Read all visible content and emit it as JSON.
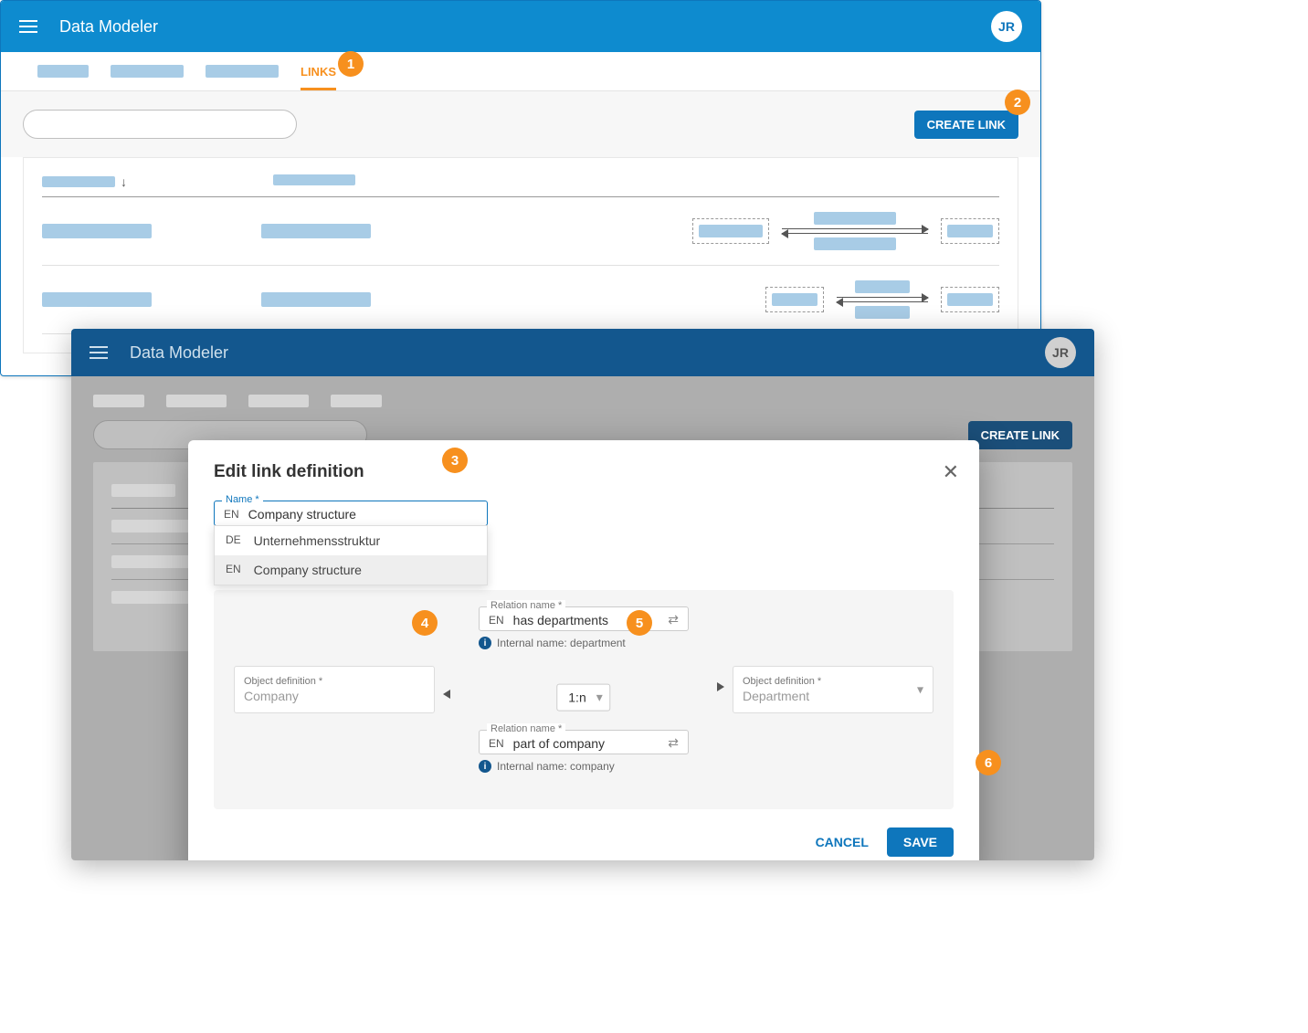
{
  "header": {
    "app_title": "Data Modeler",
    "avatar": "JR"
  },
  "tabs": {
    "active_label": "LINKS"
  },
  "toolbar": {
    "create_link": "CREATE LINK"
  },
  "modal": {
    "title": "Edit link definition",
    "name_label": "Name *",
    "name_lang": "EN",
    "name_value": "Company structure",
    "dropdown": [
      {
        "lang": "DE",
        "text": "Unternehmensstruktur"
      },
      {
        "lang": "EN",
        "text": "Company structure"
      }
    ],
    "relation1": {
      "label": "Relation name *",
      "lang": "EN",
      "value": "has departments",
      "internal": "Internal name: department"
    },
    "relation2": {
      "label": "Relation name *",
      "lang": "EN",
      "value": "part of company",
      "internal": "Internal name: company"
    },
    "left_obj": {
      "label": "Object definition *",
      "value": "Company"
    },
    "right_obj": {
      "label": "Object definition *",
      "value": "Department"
    },
    "cardinality": "1:n",
    "cancel": "CANCEL",
    "save": "SAVE"
  },
  "badges": [
    "1",
    "2",
    "3",
    "4",
    "5",
    "6"
  ]
}
